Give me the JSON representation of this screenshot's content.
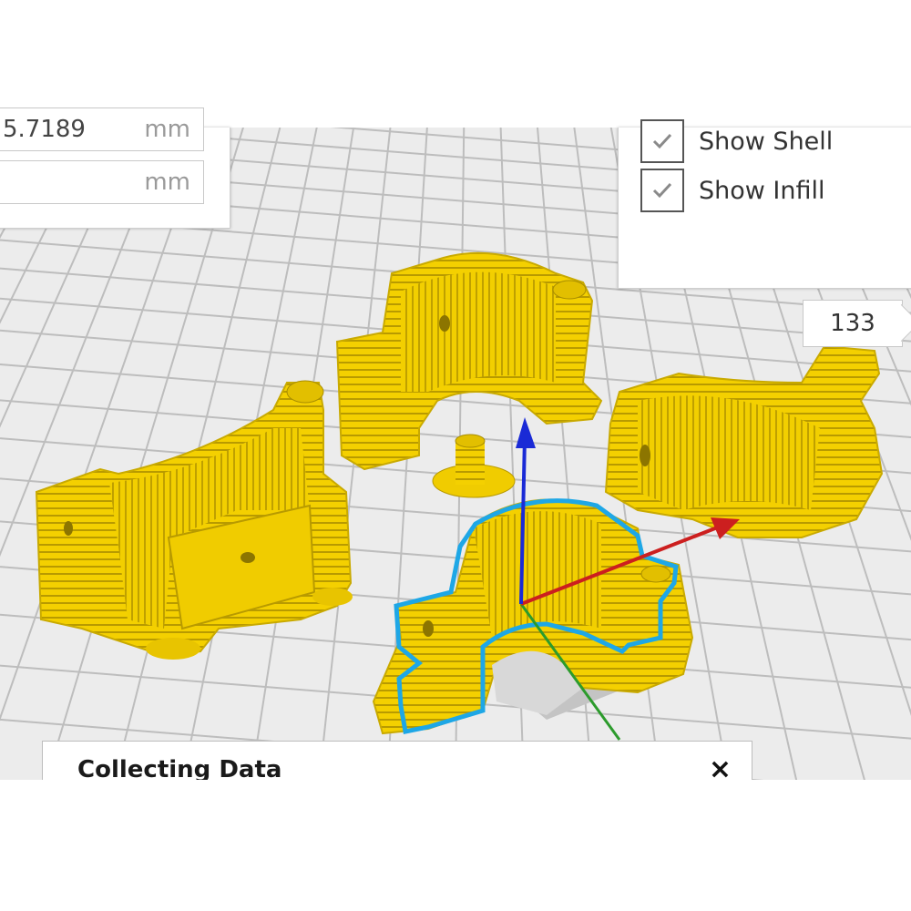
{
  "dimensions_panel": {
    "fields": [
      {
        "value": "5.7189",
        "unit": "mm"
      },
      {
        "value": "",
        "unit": "mm"
      }
    ]
  },
  "view_options": {
    "show_shell": {
      "label": "Show Shell",
      "checked": true
    },
    "show_infill": {
      "label": "Show Infill",
      "checked": true
    }
  },
  "layer_slider": {
    "current_layer": "133"
  },
  "toast": {
    "title": "Collecting Data",
    "close_symbol": "×"
  },
  "colors": {
    "model_yellow": "#f4d000",
    "selection_outline": "#1ea7e6",
    "axis_x": "#cc1f1f",
    "axis_y": "#2c9b2c",
    "axis_z": "#1a2ad6",
    "grid_line": "#c9c9c9"
  },
  "icons": [
    "check-icon",
    "close-icon",
    "axis-gizmo"
  ]
}
